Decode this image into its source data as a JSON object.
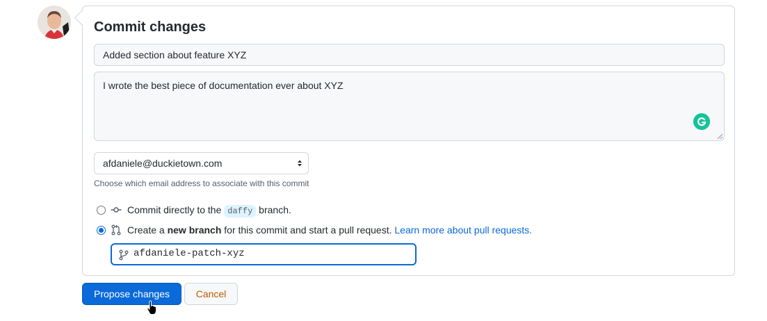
{
  "commit": {
    "title": "Commit changes",
    "summary_value": "Added section about feature XYZ",
    "description_value": "I wrote the best piece of documentation ever about XYZ"
  },
  "email": {
    "selected": "afdaniele@duckietown.com",
    "hint": "Choose which email address to associate with this commit"
  },
  "options": {
    "direct": {
      "prefix": "Commit directly to the",
      "branch": "daffy",
      "suffix": "branch.",
      "selected": false
    },
    "new_branch": {
      "prefix": "Create a",
      "bold": "new branch",
      "suffix": "for this commit and start a pull request.",
      "link": "Learn more about pull requests.",
      "selected": true
    }
  },
  "branch_name": "afdaniele-patch-xyz",
  "buttons": {
    "propose": "Propose changes",
    "cancel": "Cancel"
  },
  "icons": {
    "avatar": "user-avatar",
    "grammarly": "grammarly-icon",
    "commit": "git-commit-icon",
    "pull_request": "git-pull-request-icon",
    "branch": "git-branch-icon",
    "select": "select-arrows-icon",
    "cursor": "hand-pointer-cursor"
  },
  "colors": {
    "primary": "#0a6ad9",
    "link": "#0969da",
    "cancel_text": "#bf5a00",
    "grammarly": "#15c39a"
  }
}
